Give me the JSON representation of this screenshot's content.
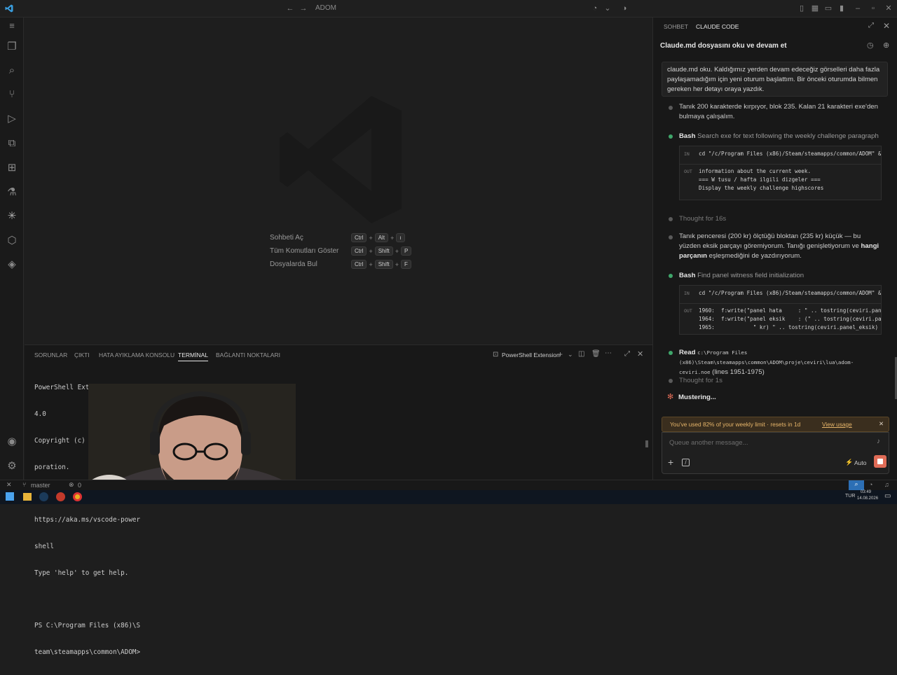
{
  "titlebar": {
    "title": "ADOM"
  },
  "editor": {
    "shortcuts": [
      {
        "label": "Sohbeti Aç",
        "keys": [
          "Ctrl",
          "Alt",
          "ı"
        ]
      },
      {
        "label": "Tüm Komutları Göster",
        "keys": [
          "Ctrl",
          "Shift",
          "P"
        ]
      },
      {
        "label": "Dosyalarda Bul",
        "keys": [
          "Ctrl",
          "Shift",
          "F"
        ]
      }
    ]
  },
  "panel": {
    "tabs": [
      "SORUNLAR",
      "ÇIKTI",
      "HATA AYIKLAMA KONSOLU",
      "TERMİNAL",
      "BAĞLANTI NOKTALARI"
    ],
    "terminal_name": "PowerShell Extension",
    "lines": [
      "PowerShell Extension v2025.",
      "4.0",
      "Copyright (c) Microsoft Cor",
      "poration.",
      "",
      "https://aka.ms/vscode-power",
      "shell",
      "Type 'help' to get help.",
      "",
      "PS C:\\Program Files (x86)\\S",
      "team\\steamapps\\common\\ADOM>"
    ]
  },
  "statusbar": {
    "branch": "master",
    "errors": "0"
  },
  "taskbar": {
    "lang": "TUR",
    "time": "03:49",
    "date": "14.08.2026"
  },
  "chat": {
    "tabs": [
      "SOHBET",
      "CLAUDE CODE"
    ],
    "title": "Claude.md dosyasını oku ve devam et",
    "user_msg": "claude.md oku. Kaldığımız yerden devam edeceğiz görselleri daha fazla paylaşamadığım için yeni oturum başlattım. Bir önceki oturumda bilmen gereken her detayı oraya yazdık.",
    "msg1": "Tanık 200 karakterde kırpıyor, blok 235. Kalan 21 karakteri exe'den bulmaya çalışalım.",
    "bash1_tag": "Bash",
    "bash1_desc": "Search exe for text following the weekly challenge paragraph",
    "io_in": "IN",
    "io_out": "OUT",
    "bash1_in": "cd \"/c/Program Files (x86)/Steam/steamapps/common/ADOM\" &&",
    "bash1_out": [
      "information about the current week.",
      "=== W tusu / hafta ilgili dizgeler ===",
      "Display the weekly challenge highscores"
    ],
    "thought1": "Thought for 16s",
    "msg2a": "Tanık penceresi (200 kr) ölçtüğü bloktan (235 kr) küçük — bu yüzden eksik parçayı göremiyorum. Tanığı genişletiyorum ve ",
    "msg2b": "hangi parçanın",
    "msg2c": " eşleşmediğini de yazdırıyorum.",
    "bash2_tag": "Bash",
    "bash2_desc": "Find panel witness field initialization",
    "bash2_in": "cd \"/c/Program Files (x86)/Steam/steamapps/common/ADOM\" &&",
    "bash2_out": [
      "1960:  f:write(\"panel hata     : \" .. tostring(ceviri.panel",
      "1964:  f:write(\"panel eksik    : (\" .. tostring(ceviri.pane",
      "1965:            \" kr) \" .. tostring(ceviri.panel_eksik) .. '"
    ],
    "read_tag": "Read",
    "read_path": "c:\\Program Files (x86)\\Steam\\steamapps\\common\\ADOM\\proje\\ceviri\\lua\\adom-ceviri.noe",
    "read_lines": "(lines 1951-1975)",
    "thought2": "Thought for 1s",
    "status": "Mustering...",
    "banner": "You've used 82% of your weekly limit · resets in 1d",
    "banner_link": "View usage",
    "input_placeholder": "Queue another message...",
    "mode": "Auto"
  }
}
